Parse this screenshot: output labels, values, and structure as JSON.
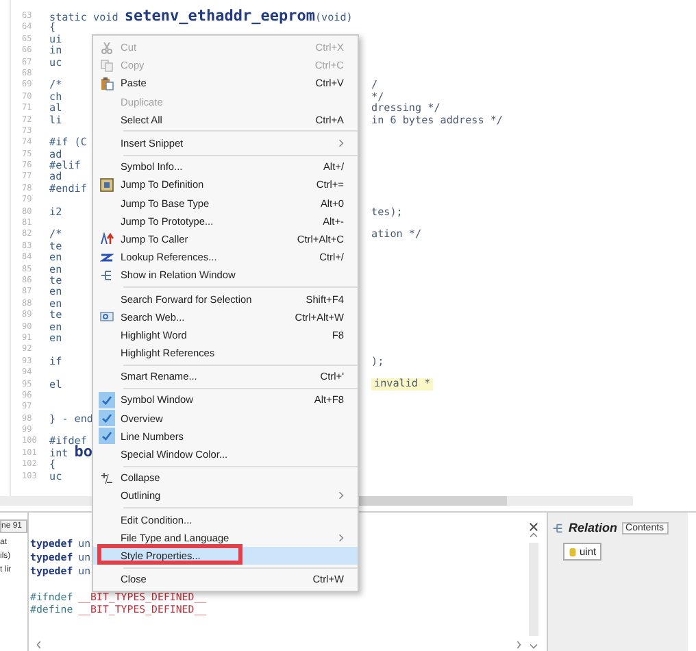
{
  "editor": {
    "lines": [
      {
        "num": "63",
        "left": "static void **setenv_ethaddr_eeprom**(void)"
      },
      {
        "num": "64",
        "left": "{"
      },
      {
        "num": "65",
        "left": "ui"
      },
      {
        "num": "66",
        "left": "in"
      },
      {
        "num": "67",
        "left": "uc"
      },
      {
        "num": "68"
      },
      {
        "num": "69",
        "left": "/*",
        "right": "/"
      },
      {
        "num": "70",
        "left": "ch",
        "right": "*/"
      },
      {
        "num": "71",
        "left": "al",
        "right": "dressing */"
      },
      {
        "num": "72",
        "left": "li",
        "right": "in 6 bytes address */"
      },
      {
        "num": "73"
      },
      {
        "num": "74",
        "left": "#if (C"
      },
      {
        "num": "75",
        "left": "ad"
      },
      {
        "num": "76",
        "left": "#elif"
      },
      {
        "num": "77",
        "left": "ad"
      },
      {
        "num": "78",
        "left": "#endif"
      },
      {
        "num": "79"
      },
      {
        "num": "80",
        "left": "i2",
        "right": "tes);"
      },
      {
        "num": "81"
      },
      {
        "num": "82",
        "left": "/*",
        "right": "ation */"
      },
      {
        "num": "83",
        "left": "te"
      },
      {
        "num": "84",
        "left": "en"
      },
      {
        "num": "85",
        "left": "en"
      },
      {
        "num": "86",
        "left": "te"
      },
      {
        "num": "87",
        "left": "en"
      },
      {
        "num": "88",
        "left": "en"
      },
      {
        "num": "89",
        "left": "te"
      },
      {
        "num": "90",
        "left": "en"
      },
      {
        "num": "91",
        "left": "en"
      },
      {
        "num": "92"
      },
      {
        "num": "93",
        "left": "if",
        "right": ");"
      },
      {
        "num": "94"
      },
      {
        "num": "95",
        "left": "el",
        "right": "invalid *",
        "highlighted": true
      },
      {
        "num": "96"
      },
      {
        "num": "97"
      },
      {
        "num": "98",
        "left": "} - end"
      },
      {
        "num": "99"
      },
      {
        "num": "100",
        "left": "#ifdef"
      },
      {
        "num": "101",
        "left": "int **bo**"
      },
      {
        "num": "102",
        "left": "{"
      },
      {
        "num": "103",
        "left": "uc"
      }
    ]
  },
  "context_menu": {
    "items": [
      {
        "kind": "item",
        "label": "Cut",
        "shortcut": "Ctrl+X",
        "disabled": true,
        "selected": false
      },
      {
        "kind": "item",
        "label": "Copy",
        "shortcut": "Ctrl+C",
        "disabled": true,
        "selected": false
      },
      {
        "kind": "item",
        "label": "Paste",
        "shortcut": "Ctrl+V",
        "disabled": false,
        "selected": false
      },
      {
        "kind": "item",
        "label": "Duplicate",
        "disabled": true,
        "selected": false
      },
      {
        "kind": "item",
        "label": "Select All",
        "shortcut": "Ctrl+A",
        "disabled": false,
        "selected": false
      },
      {
        "kind": "separator"
      },
      {
        "kind": "item",
        "label": "Insert Snippet",
        "submenu": true,
        "disabled": false,
        "selected": false
      },
      {
        "kind": "separator"
      },
      {
        "kind": "item",
        "label": "Symbol Info...",
        "shortcut": "Alt+/",
        "disabled": false,
        "selected": false
      },
      {
        "kind": "item",
        "label": "Jump To Definition",
        "shortcut": "Ctrl+=",
        "disabled": false,
        "selected": false
      },
      {
        "kind": "item",
        "label": "Jump To Base Type",
        "shortcut": "Alt+0",
        "disabled": false,
        "selected": false
      },
      {
        "kind": "item",
        "label": "Jump To Prototype...",
        "shortcut": "Alt+-",
        "disabled": false,
        "selected": false
      },
      {
        "kind": "item",
        "label": "Jump To Caller",
        "shortcut": "Ctrl+Alt+C",
        "disabled": false,
        "selected": false
      },
      {
        "kind": "item",
        "label": "Lookup References...",
        "shortcut": "Ctrl+/",
        "disabled": false,
        "selected": false
      },
      {
        "kind": "item",
        "label": "Show in Relation Window",
        "disabled": false,
        "selected": false
      },
      {
        "kind": "separator"
      },
      {
        "kind": "item",
        "label": "Search Forward for Selection",
        "shortcut": "Shift+F4",
        "disabled": false,
        "selected": false
      },
      {
        "kind": "item",
        "label": "Search Web...",
        "shortcut": "Ctrl+Alt+W",
        "disabled": false,
        "selected": false
      },
      {
        "kind": "item",
        "label": "Highlight Word",
        "shortcut": "F8",
        "disabled": false,
        "selected": false
      },
      {
        "kind": "item",
        "label": "Highlight References",
        "disabled": false,
        "selected": false
      },
      {
        "kind": "separator"
      },
      {
        "kind": "item",
        "label": "Smart Rename...",
        "shortcut": "Ctrl+'",
        "disabled": false,
        "selected": false
      },
      {
        "kind": "separator"
      },
      {
        "kind": "check",
        "label": "Symbol Window",
        "shortcut": "Alt+F8",
        "checked": true,
        "selected": false
      },
      {
        "kind": "check",
        "label": "Overview",
        "checked": true,
        "selected": false
      },
      {
        "kind": "check",
        "label": "Line Numbers",
        "checked": true,
        "selected": false
      },
      {
        "kind": "check",
        "label": "Special Window Color...",
        "checked": false,
        "selected": false
      },
      {
        "kind": "separator"
      },
      {
        "kind": "item",
        "label": "Collapse",
        "disabled": false,
        "selected": false
      },
      {
        "kind": "item",
        "label": "Outlining",
        "submenu": true,
        "disabled": false,
        "selected": false
      },
      {
        "kind": "separator"
      },
      {
        "kind": "item",
        "label": "Edit Condition...",
        "disabled": false,
        "selected": false
      },
      {
        "kind": "item",
        "label": "File Type and Language",
        "submenu": true,
        "disabled": false,
        "selected": false
      },
      {
        "kind": "item",
        "label": "Style Properties...",
        "disabled": false,
        "selected": true,
        "marked": true
      },
      {
        "kind": "separator"
      },
      {
        "kind": "item",
        "label": "Close",
        "shortcut": "Ctrl+W",
        "disabled": false,
        "selected": false
      }
    ]
  },
  "side_pane": {
    "tab": "ne 91",
    "lines": [
      "at",
      "ils)",
      "t lir"
    ]
  },
  "bottom_code": {
    "lines": [
      {
        "kind": "typedef",
        "keyword": "typedef",
        "text": "un"
      },
      {
        "kind": "typedef",
        "keyword": "typedef",
        "text": "un"
      },
      {
        "kind": "typedef",
        "keyword": "typedef",
        "text": "un"
      },
      {
        "kind": "blank"
      },
      {
        "kind": "directive",
        "keyword": "#ifndef",
        "text": "__BIT_TYPES_DEFINED__"
      },
      {
        "kind": "directive",
        "keyword": "#define",
        "text": "__BIT_TYPES_DEFINED__"
      }
    ]
  },
  "relation_panel": {
    "title": "Relation",
    "tab": "Contents",
    "items": [
      "uint"
    ]
  }
}
